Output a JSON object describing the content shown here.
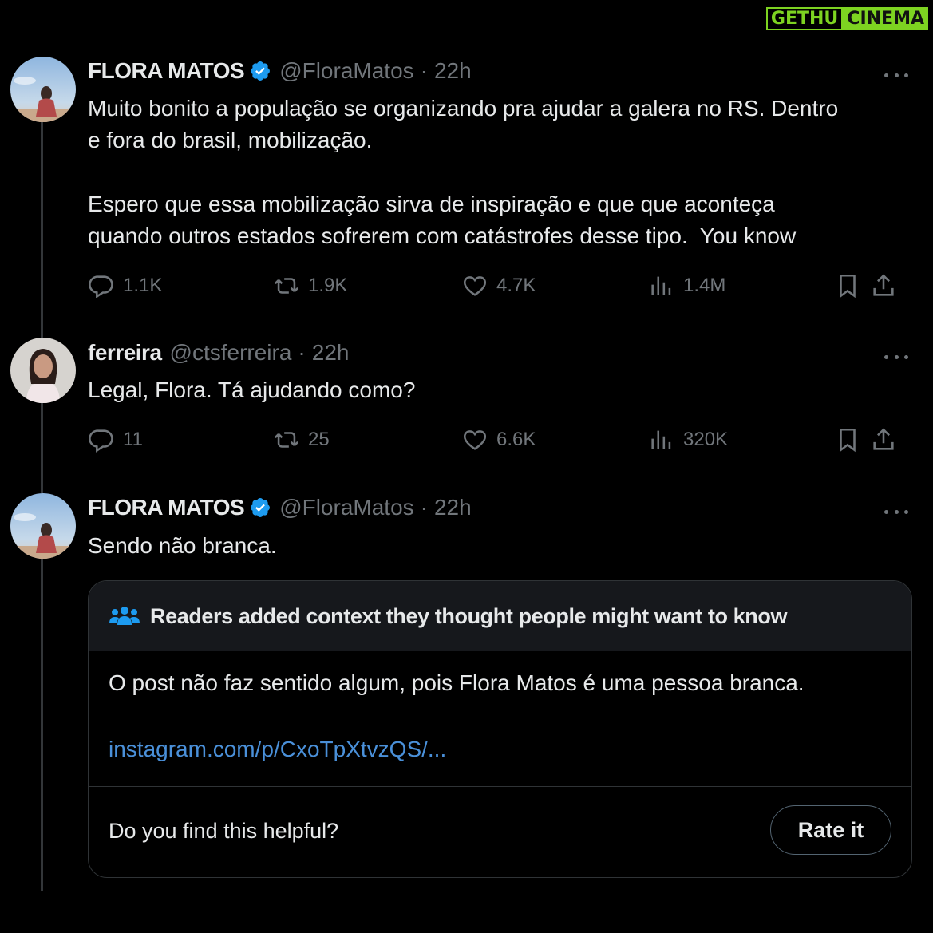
{
  "watermark": {
    "part1": "GETHU",
    "part2": "CINEMA"
  },
  "tweets": [
    {
      "name": "FLORA MATOS",
      "handle": "@FloraMatos",
      "time": "22h",
      "text_p1": "Muito bonito a população se organizando pra ajudar a galera no RS. Dentro\ne fora do brasil, mobilização.",
      "text_p2": "Espero que essa mobilização sirva de inspiração e que que aconteça\nquando outros estados sofrerem com catástrofes desse tipo.  You know",
      "replies": "1.1K",
      "reposts": "1.9K",
      "likes": "4.7K",
      "views": "1.4M"
    },
    {
      "name": "ferreira",
      "handle": "@ctsferreira",
      "time": "22h",
      "text": "Legal, Flora. Tá ajudando como?",
      "replies": "11",
      "reposts": "25",
      "likes": "6.6K",
      "views": "320K"
    },
    {
      "name": "FLORA MATOS",
      "handle": "@FloraMatos",
      "time": "22h",
      "text": "Sendo não branca."
    }
  ],
  "separator": "·",
  "community_note": {
    "title": "Readers added context they thought people might want to know",
    "body": "O post não faz sentido algum, pois Flora Matos é uma pessoa branca.",
    "link": "instagram.com/p/CxoTpXtvzQS/...",
    "question": "Do you find this helpful?",
    "rate_label": "Rate it"
  },
  "colors": {
    "background": "#000000",
    "muted": "#71767b",
    "verified": "#1d9bf0",
    "link": "#4a90d9",
    "watermark": "#7dd321"
  }
}
